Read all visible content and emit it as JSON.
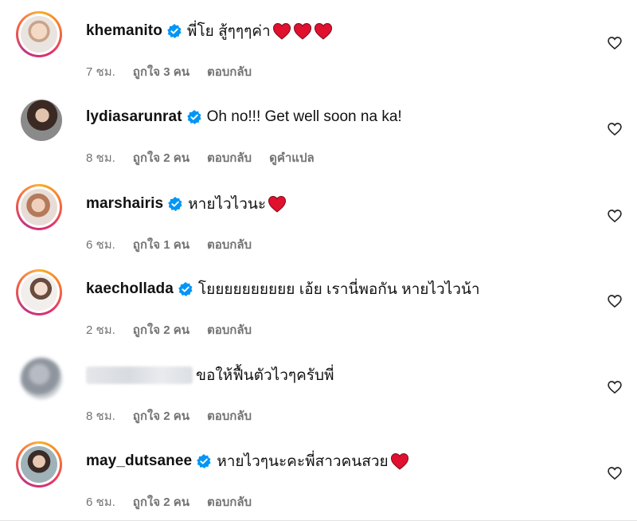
{
  "comments": [
    {
      "username": "khemanito",
      "verified": true,
      "text": "พี่โย สู้ๆๆๆค่า",
      "heart_count": 3,
      "time": "7 ชม.",
      "likes": "ถูกใจ 3 คน",
      "reply": "ตอบกลับ",
      "translate": ""
    },
    {
      "username": "lydiasarunrat",
      "verified": true,
      "text": "Oh no!!! Get well soon na ka!",
      "heart_count": 0,
      "time": "8 ชม.",
      "likes": "ถูกใจ 2 คน",
      "reply": "ตอบกลับ",
      "translate": "ดูคำแปล"
    },
    {
      "username": "marshairis",
      "verified": true,
      "text": "หายไวไวนะ",
      "heart_count": 1,
      "time": "6 ชม.",
      "likes": "ถูกใจ 1 คน",
      "reply": "ตอบกลับ",
      "translate": ""
    },
    {
      "username": "kaechollada",
      "verified": true,
      "text": "โยยยยยยยยยย เอ้ย เรานี่พอกัน หายไวไวน้า",
      "heart_count": 0,
      "time": "2 ชม.",
      "likes": "ถูกใจ 2 คน",
      "reply": "ตอบกลับ",
      "translate": ""
    },
    {
      "username": "",
      "verified": false,
      "text": "ขอให้ฟื้นตัวไวๆครับพี่",
      "heart_count": 0,
      "time": "8 ชม.",
      "likes": "ถูกใจ 2 คน",
      "reply": "ตอบกลับ",
      "translate": ""
    },
    {
      "username": "may_dutsanee",
      "verified": true,
      "text": "หายไวๆนะคะพี่สาวคนสวย",
      "heart_count": 1,
      "time": "6 ชม.",
      "likes": "ถูกใจ 2 คน",
      "reply": "ตอบกลับ",
      "translate": ""
    }
  ],
  "colors": {
    "verified_badge": "#0095f6",
    "heart_emoji": "#e0102f",
    "meta_text": "#737373",
    "username_text": "#111111"
  },
  "icons": {
    "verified": "verified-badge-icon",
    "like": "heart-outline-icon",
    "emoji": "red-heart-emoji-icon"
  }
}
